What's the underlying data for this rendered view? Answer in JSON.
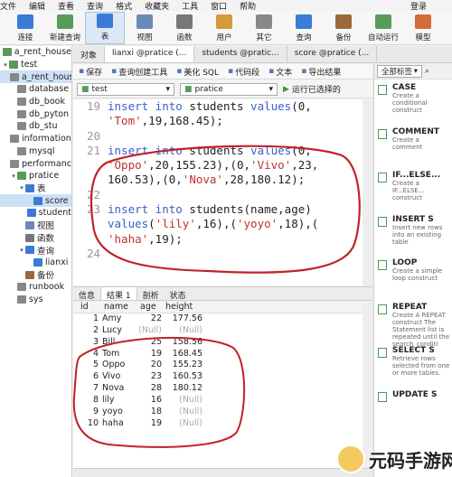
{
  "menu": [
    "文件",
    "编辑",
    "查看",
    "查询",
    "格式",
    "收藏夹",
    "工具",
    "窗口",
    "帮助"
  ],
  "login_label": "登录",
  "toolbar": [
    {
      "label": "连接",
      "icon": "connect-icon",
      "color": "#3a7bd5"
    },
    {
      "label": "新建查询",
      "icon": "new-query-icon",
      "color": "#5a9a5a"
    },
    {
      "label": "表",
      "icon": "table-icon",
      "color": "#3a7bd5",
      "active": true
    },
    {
      "label": "视图",
      "icon": "view-icon",
      "color": "#6a8ab5"
    },
    {
      "label": "函数",
      "icon": "function-icon",
      "color": "#777"
    },
    {
      "label": "用户",
      "icon": "user-icon",
      "color": "#d59a3a"
    },
    {
      "label": "其它",
      "icon": "other-icon",
      "color": "#888"
    },
    {
      "label": "查询",
      "icon": "query-icon",
      "color": "#3a7bd5"
    },
    {
      "label": "备份",
      "icon": "backup-icon",
      "color": "#9a6a3a"
    },
    {
      "label": "自动运行",
      "icon": "autorun-icon",
      "color": "#5a9a5a"
    },
    {
      "label": "模型",
      "icon": "model-icon",
      "color": "#d56a3a"
    }
  ],
  "sidebar": [
    {
      "label": "a_rent_house",
      "level": 0,
      "arrow": "",
      "icon_color": "#5a9a5a"
    },
    {
      "label": "test",
      "level": 0,
      "arrow": "▾",
      "icon_color": "#5a9a5a"
    },
    {
      "label": "a_rent_housi",
      "level": 1,
      "arrow": "",
      "icon_color": "#888",
      "selected": true
    },
    {
      "label": "database",
      "level": 1,
      "arrow": "",
      "icon_color": "#888"
    },
    {
      "label": "db_book",
      "level": 1,
      "arrow": "",
      "icon_color": "#888"
    },
    {
      "label": "db_pyton",
      "level": 1,
      "arrow": "",
      "icon_color": "#888"
    },
    {
      "label": "db_stu",
      "level": 1,
      "arrow": "",
      "icon_color": "#888"
    },
    {
      "label": "information_",
      "level": 1,
      "arrow": "",
      "icon_color": "#888"
    },
    {
      "label": "mysql",
      "level": 1,
      "arrow": "",
      "icon_color": "#888"
    },
    {
      "label": "performance",
      "level": 1,
      "arrow": "",
      "icon_color": "#888"
    },
    {
      "label": "pratice",
      "level": 1,
      "arrow": "▾",
      "icon_color": "#5a9a5a"
    },
    {
      "label": "表",
      "level": 2,
      "arrow": "▾",
      "icon_color": "#3a7bd5"
    },
    {
      "label": "score",
      "level": 3,
      "arrow": "",
      "icon_color": "#3a7bd5",
      "selected": true
    },
    {
      "label": "student",
      "level": 3,
      "arrow": "",
      "icon_color": "#3a7bd5"
    },
    {
      "label": "视图",
      "level": 2,
      "arrow": "",
      "icon_color": "#6a8ab5"
    },
    {
      "label": "函数",
      "level": 2,
      "arrow": "",
      "icon_color": "#777"
    },
    {
      "label": "查询",
      "level": 2,
      "arrow": "▾",
      "icon_color": "#3a7bd5"
    },
    {
      "label": "lianxi",
      "level": 3,
      "arrow": "",
      "icon_color": "#3a7bd5"
    },
    {
      "label": "备份",
      "level": 2,
      "arrow": "",
      "icon_color": "#9a6a3a"
    },
    {
      "label": "runbook",
      "level": 1,
      "arrow": "",
      "icon_color": "#888"
    },
    {
      "label": "sys",
      "level": 1,
      "arrow": "",
      "icon_color": "#888"
    }
  ],
  "tabs": [
    {
      "label": "对象",
      "active": false
    },
    {
      "label": "lianxi @pratice (...",
      "active": true
    },
    {
      "label": "students @pratic...",
      "active": false
    },
    {
      "label": "score @pratice (...",
      "active": false
    }
  ],
  "subtoolbar": [
    "保存",
    "查询创建工具",
    "美化 SQL",
    "代码段",
    "文本",
    "导出结果"
  ],
  "dbbar": {
    "connection": "test",
    "database": "pratice",
    "run_label": "运行已选择的"
  },
  "code_lines": [
    {
      "num": "19",
      "parts": [
        [
          "kw",
          "insert into "
        ],
        [
          "num",
          "students "
        ],
        [
          "kw",
          "values"
        ],
        [
          "num",
          "(0,"
        ]
      ]
    },
    {
      "num": "",
      "parts": [
        [
          "str",
          "'Tom'"
        ],
        [
          "num",
          ",19,168.45);"
        ]
      ]
    },
    {
      "num": "20",
      "parts": []
    },
    {
      "num": "21",
      "parts": [
        [
          "kw",
          "insert into "
        ],
        [
          "num",
          "students "
        ],
        [
          "kw",
          "values"
        ],
        [
          "num",
          "(0,"
        ]
      ]
    },
    {
      "num": "",
      "parts": [
        [
          "str",
          "'Oppo'"
        ],
        [
          "num",
          ",20,155.23),(0,"
        ],
        [
          "str",
          "'Vivo'"
        ],
        [
          "num",
          ",23,"
        ]
      ]
    },
    {
      "num": "",
      "parts": [
        [
          "num",
          "160.53),(0,"
        ],
        [
          "str",
          "'Nova'"
        ],
        [
          "num",
          ",28,180.12);"
        ]
      ]
    },
    {
      "num": "22",
      "parts": []
    },
    {
      "num": "23",
      "parts": [
        [
          "kw",
          "insert into "
        ],
        [
          "num",
          "students(name,age)"
        ]
      ]
    },
    {
      "num": "",
      "parts": [
        [
          "kw",
          "values"
        ],
        [
          "num",
          "("
        ],
        [
          "str",
          "'lily'"
        ],
        [
          "num",
          ",16),("
        ],
        [
          "str",
          "'yoyo'"
        ],
        [
          "num",
          ",18),("
        ]
      ]
    },
    {
      "num": "",
      "parts": [
        [
          "str",
          "'haha'"
        ],
        [
          "num",
          ",19);"
        ]
      ]
    },
    {
      "num": "24",
      "parts": []
    }
  ],
  "result_tabs": [
    {
      "label": "信息",
      "active": false
    },
    {
      "label": "结果 1",
      "active": true
    },
    {
      "label": "剖析",
      "active": false
    },
    {
      "label": "状态",
      "active": false
    }
  ],
  "table": {
    "headers": [
      "id",
      "name",
      "age",
      "height"
    ],
    "rows": [
      [
        "1",
        "Amy",
        "22",
        "177.56"
      ],
      [
        "2",
        "Lucy",
        "(Null)",
        "(Null)"
      ],
      [
        "3",
        "Bill",
        "25",
        "158.56"
      ],
      [
        "4",
        "Tom",
        "19",
        "168.45"
      ],
      [
        "5",
        "Oppo",
        "20",
        "155.23"
      ],
      [
        "6",
        "Vivo",
        "23",
        "160.53"
      ],
      [
        "7",
        "Nova",
        "28",
        "180.12"
      ],
      [
        "8",
        "lily",
        "16",
        "(Null)"
      ],
      [
        "9",
        "yoyo",
        "18",
        "(Null)"
      ],
      [
        "10",
        "haha",
        "19",
        "(Null)"
      ]
    ]
  },
  "right_panel": {
    "dropdown": "全部标签",
    "snippets": [
      {
        "title": "CASE",
        "desc": "Create a conditional construct"
      },
      {
        "title": "COMMENT",
        "desc": "Create a comment"
      },
      {
        "title": "IF...ELSE...",
        "desc": "Create a IF...ELSE... construct"
      },
      {
        "title": "INSERT S",
        "desc": "Insert new rows into an existing table"
      },
      {
        "title": "LOOP",
        "desc": "Create a simple loop construct"
      },
      {
        "title": "REPEAT",
        "desc": "Create A REPEAT construct The Statement list is repeated until the search_conditi"
      },
      {
        "title": "SELECT S",
        "desc": "Retrieve rows selected from one or more tables."
      },
      {
        "title": "UPDATE S",
        "desc": ""
      }
    ]
  },
  "watermark": "元码手游网"
}
